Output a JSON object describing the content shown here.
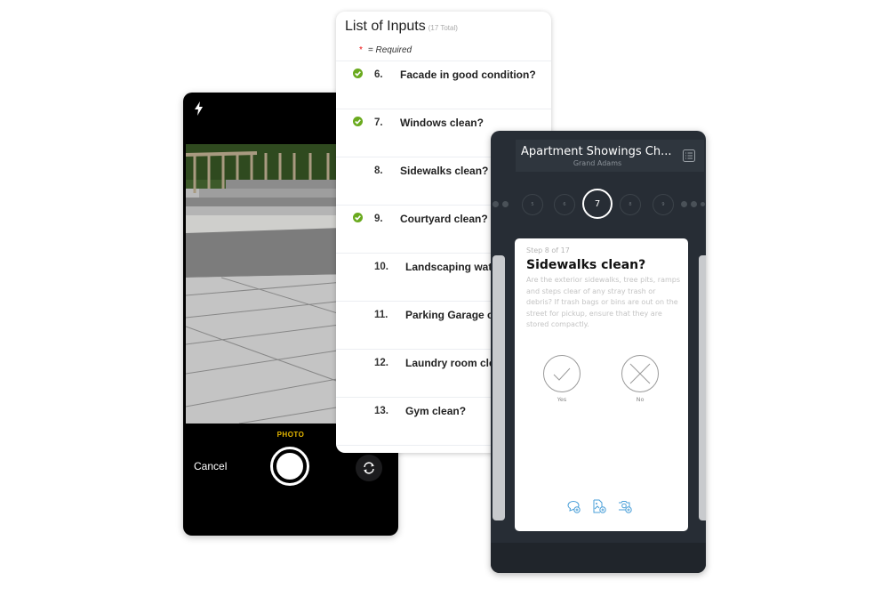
{
  "camera": {
    "mode_label": "PHOTO",
    "cancel_label": "Cancel",
    "icons": {
      "flash": "flash-icon",
      "flip": "flip-camera-icon",
      "shutter": "shutter-button"
    }
  },
  "list": {
    "title": "List of Inputs",
    "total": "(17 Total)",
    "required_star": "*",
    "required_label": "= Required",
    "items": [
      {
        "num": "6.",
        "label": "Facade in good condition?",
        "completed": true
      },
      {
        "num": "7.",
        "label": "Windows clean?",
        "completed": true
      },
      {
        "num": "8.",
        "label": "Sidewalks clean?",
        "completed": false
      },
      {
        "num": "9.",
        "label": "Courtyard clean?",
        "completed": true
      },
      {
        "num": "10.",
        "label": "Landscaping watered?",
        "completed": false
      },
      {
        "num": "11.",
        "label": "Parking Garage clean?",
        "completed": false
      },
      {
        "num": "12.",
        "label": "Laundry room clean?",
        "completed": false
      },
      {
        "num": "13.",
        "label": "Gym clean?",
        "completed": false
      }
    ],
    "check_color": "#6aaa1e"
  },
  "checklist": {
    "title": "Apartment Showings Ch...",
    "subtitle": "Grand Adams",
    "steps": [
      "5",
      "6",
      "7",
      "8",
      "9"
    ],
    "current_step": "7",
    "step_of": "Step 8 of 17",
    "question": "Sidewalks clean?",
    "description": "Are the exterior sidewalks, tree pits, ramps and steps clear of any stray trash or debris? If trash bags or bins are out on the street for pickup, ensure that they are stored compactly.",
    "yes_label": "Yes",
    "no_label": "No",
    "tools": [
      "add-comment-icon",
      "add-document-icon",
      "add-photo-icon"
    ],
    "accent_color": "#4a9fd8"
  }
}
